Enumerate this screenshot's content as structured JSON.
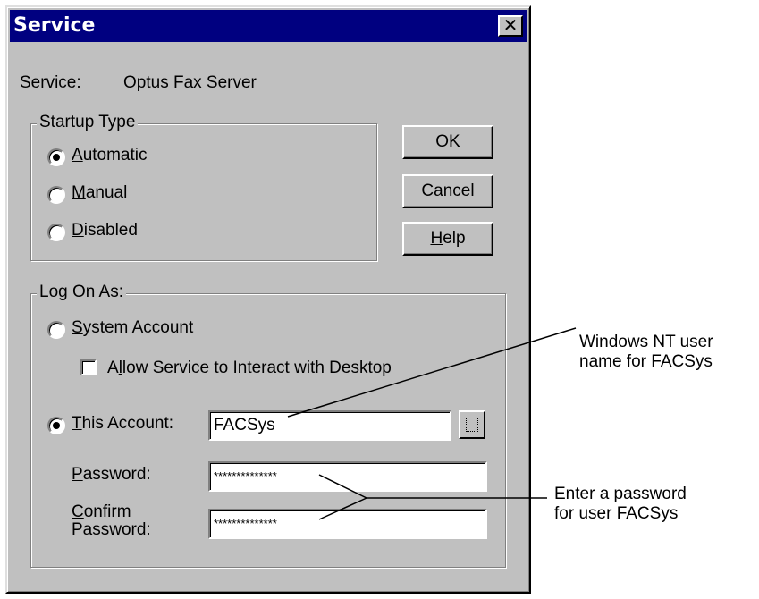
{
  "window": {
    "title": "Service"
  },
  "service": {
    "label": "Service:",
    "name": "Optus Fax Server"
  },
  "startup": {
    "legend": "Startup Type",
    "options": [
      {
        "accel": "A",
        "rest": "utomatic",
        "selected": true
      },
      {
        "accel": "M",
        "rest": "anual",
        "selected": false
      },
      {
        "accel": "D",
        "rest": "isabled",
        "selected": false
      }
    ]
  },
  "buttons": {
    "ok": "OK",
    "cancel": "Cancel",
    "help_accel": "H",
    "help_rest": "elp"
  },
  "logon": {
    "legend": "Log On As:",
    "system_accel": "S",
    "system_rest": "ystem Account",
    "interact_pre": "A",
    "interact_accel": "l",
    "interact_rest": "low Service to Interact with Desktop",
    "this_accel": "T",
    "this_rest": "his Account:",
    "account_value": "FACSys",
    "password_accel": "P",
    "password_rest": "assword:",
    "password_value": "**************",
    "confirm_accel": "C",
    "confirm_rest": "onfirm",
    "confirm_line2": "Password:",
    "confirm_value": "**************"
  },
  "callouts": {
    "user_line1": "Windows NT user",
    "user_line2": "name for FACSys",
    "pw_line1": "Enter a password",
    "pw_line2": "for user FACSys"
  }
}
